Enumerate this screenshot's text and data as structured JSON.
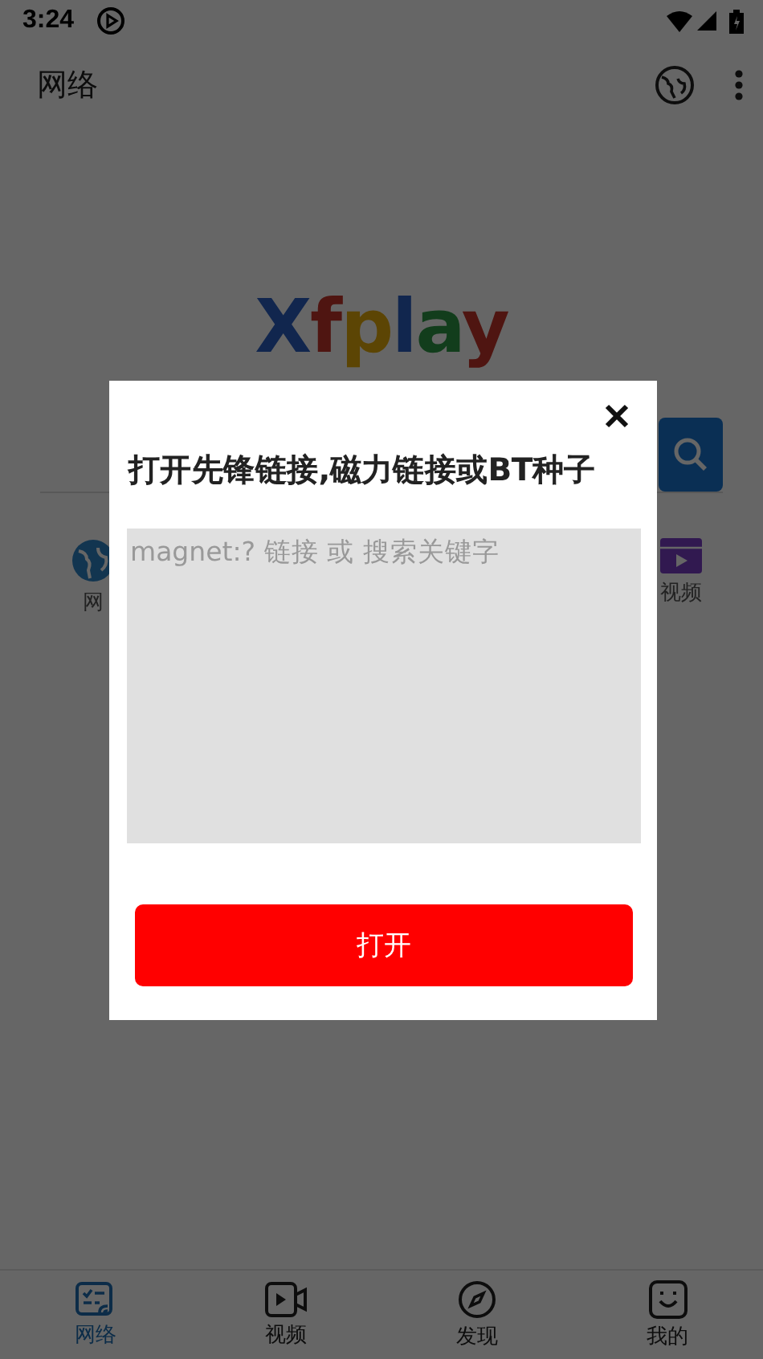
{
  "status_bar": {
    "time": "3:24"
  },
  "app_bar": {
    "title": "网络"
  },
  "home": {
    "logo": "Xfplay",
    "shortcuts": [
      {
        "label": "网",
        "kind": "globe"
      },
      {
        "label": "视频",
        "kind": "video"
      }
    ]
  },
  "dialog": {
    "title": "打开先锋链接,磁力链接或BT种子",
    "input": {
      "placeholder": "magnet:? 链接 或 搜索关键字"
    },
    "button": "打开"
  },
  "bottom_nav": [
    {
      "label": "网络",
      "kind": "network",
      "selected": true
    },
    {
      "label": "视频",
      "kind": "video",
      "selected": false
    },
    {
      "label": "发现",
      "kind": "compass",
      "selected": false
    },
    {
      "label": "我的",
      "kind": "face",
      "selected": false
    }
  ]
}
